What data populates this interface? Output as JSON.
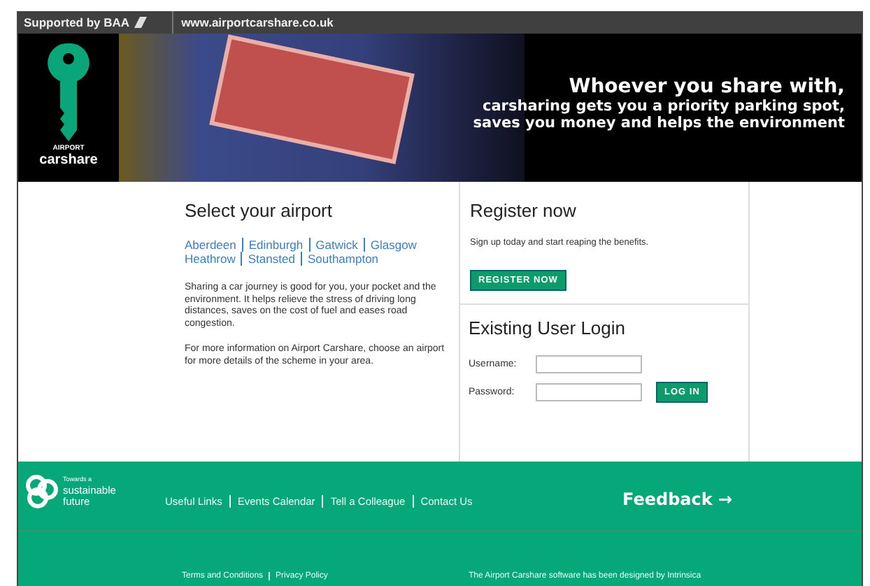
{
  "top_bar": {
    "supported_by": "Supported by BAA",
    "url": "www.airportcarshare.co.uk"
  },
  "banner": {
    "logo_top": "AIRPORT",
    "logo_bottom": "carshare",
    "headline": "Whoever you share with,",
    "lines": [
      "carsharing gets you a priority parking spot,",
      "saves you money and helps the environment"
    ]
  },
  "select_airport": {
    "heading": "Select your airport",
    "airports": [
      "Aberdeen",
      "Edinburgh",
      "Gatwick",
      "Glasgow",
      "Heathrow",
      "Stansted",
      "Southampton"
    ],
    "paragraphs": [
      "Sharing a car journey is good for you, your pocket and the environment. It helps relieve the stress of driving long distances, saves on the cost of fuel and eases road congestion.",
      "For more information on Airport Carshare, choose an airport for more details of the scheme in your area."
    ]
  },
  "register": {
    "heading": "Register now",
    "text": "Sign up today and start reaping the benefits.",
    "button": "REGISTER NOW"
  },
  "login": {
    "heading": "Existing User Login",
    "fields": [
      {
        "label": "Username:"
      },
      {
        "label": "Password:"
      }
    ],
    "button": "LOG IN"
  },
  "footer": {
    "logo_small": "Towards a",
    "logo_lines": [
      "sustainable",
      "future"
    ],
    "links": [
      "Useful Links",
      "Events Calendar",
      "Tell a Colleague",
      "Contact Us"
    ],
    "feedback": "Feedback →",
    "bottom_links": [
      "Terms and Conditions",
      "Privacy Policy"
    ],
    "credit": "The Airport Carshare software has been designed by Intrinsica"
  }
}
